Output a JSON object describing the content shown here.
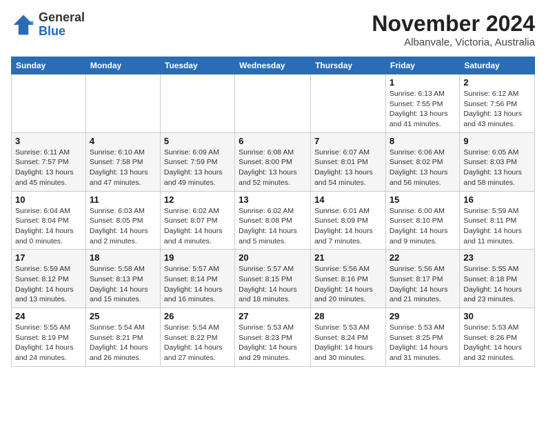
{
  "logo": {
    "general": "General",
    "blue": "Blue"
  },
  "header": {
    "month_year": "November 2024",
    "location": "Albanvale, Victoria, Australia"
  },
  "weekdays": [
    "Sunday",
    "Monday",
    "Tuesday",
    "Wednesday",
    "Thursday",
    "Friday",
    "Saturday"
  ],
  "weeks": [
    [
      {
        "day": "",
        "info": ""
      },
      {
        "day": "",
        "info": ""
      },
      {
        "day": "",
        "info": ""
      },
      {
        "day": "",
        "info": ""
      },
      {
        "day": "",
        "info": ""
      },
      {
        "day": "1",
        "info": "Sunrise: 6:13 AM\nSunset: 7:55 PM\nDaylight: 13 hours\nand 41 minutes."
      },
      {
        "day": "2",
        "info": "Sunrise: 6:12 AM\nSunset: 7:56 PM\nDaylight: 13 hours\nand 43 minutes."
      }
    ],
    [
      {
        "day": "3",
        "info": "Sunrise: 6:11 AM\nSunset: 7:57 PM\nDaylight: 13 hours\nand 45 minutes."
      },
      {
        "day": "4",
        "info": "Sunrise: 6:10 AM\nSunset: 7:58 PM\nDaylight: 13 hours\nand 47 minutes."
      },
      {
        "day": "5",
        "info": "Sunrise: 6:09 AM\nSunset: 7:59 PM\nDaylight: 13 hours\nand 49 minutes."
      },
      {
        "day": "6",
        "info": "Sunrise: 6:08 AM\nSunset: 8:00 PM\nDaylight: 13 hours\nand 52 minutes."
      },
      {
        "day": "7",
        "info": "Sunrise: 6:07 AM\nSunset: 8:01 PM\nDaylight: 13 hours\nand 54 minutes."
      },
      {
        "day": "8",
        "info": "Sunrise: 6:06 AM\nSunset: 8:02 PM\nDaylight: 13 hours\nand 56 minutes."
      },
      {
        "day": "9",
        "info": "Sunrise: 6:05 AM\nSunset: 8:03 PM\nDaylight: 13 hours\nand 58 minutes."
      }
    ],
    [
      {
        "day": "10",
        "info": "Sunrise: 6:04 AM\nSunset: 8:04 PM\nDaylight: 14 hours\nand 0 minutes."
      },
      {
        "day": "11",
        "info": "Sunrise: 6:03 AM\nSunset: 8:05 PM\nDaylight: 14 hours\nand 2 minutes."
      },
      {
        "day": "12",
        "info": "Sunrise: 6:02 AM\nSunset: 8:07 PM\nDaylight: 14 hours\nand 4 minutes."
      },
      {
        "day": "13",
        "info": "Sunrise: 6:02 AM\nSunset: 8:08 PM\nDaylight: 14 hours\nand 5 minutes."
      },
      {
        "day": "14",
        "info": "Sunrise: 6:01 AM\nSunset: 8:09 PM\nDaylight: 14 hours\nand 7 minutes."
      },
      {
        "day": "15",
        "info": "Sunrise: 6:00 AM\nSunset: 8:10 PM\nDaylight: 14 hours\nand 9 minutes."
      },
      {
        "day": "16",
        "info": "Sunrise: 5:59 AM\nSunset: 8:11 PM\nDaylight: 14 hours\nand 11 minutes."
      }
    ],
    [
      {
        "day": "17",
        "info": "Sunrise: 5:59 AM\nSunset: 8:12 PM\nDaylight: 14 hours\nand 13 minutes."
      },
      {
        "day": "18",
        "info": "Sunrise: 5:58 AM\nSunset: 8:13 PM\nDaylight: 14 hours\nand 15 minutes."
      },
      {
        "day": "19",
        "info": "Sunrise: 5:57 AM\nSunset: 8:14 PM\nDaylight: 14 hours\nand 16 minutes."
      },
      {
        "day": "20",
        "info": "Sunrise: 5:57 AM\nSunset: 8:15 PM\nDaylight: 14 hours\nand 18 minutes."
      },
      {
        "day": "21",
        "info": "Sunrise: 5:56 AM\nSunset: 8:16 PM\nDaylight: 14 hours\nand 20 minutes."
      },
      {
        "day": "22",
        "info": "Sunrise: 5:56 AM\nSunset: 8:17 PM\nDaylight: 14 hours\nand 21 minutes."
      },
      {
        "day": "23",
        "info": "Sunrise: 5:55 AM\nSunset: 8:18 PM\nDaylight: 14 hours\nand 23 minutes."
      }
    ],
    [
      {
        "day": "24",
        "info": "Sunrise: 5:55 AM\nSunset: 8:19 PM\nDaylight: 14 hours\nand 24 minutes."
      },
      {
        "day": "25",
        "info": "Sunrise: 5:54 AM\nSunset: 8:21 PM\nDaylight: 14 hours\nand 26 minutes."
      },
      {
        "day": "26",
        "info": "Sunrise: 5:54 AM\nSunset: 8:22 PM\nDaylight: 14 hours\nand 27 minutes."
      },
      {
        "day": "27",
        "info": "Sunrise: 5:53 AM\nSunset: 8:23 PM\nDaylight: 14 hours\nand 29 minutes."
      },
      {
        "day": "28",
        "info": "Sunrise: 5:53 AM\nSunset: 8:24 PM\nDaylight: 14 hours\nand 30 minutes."
      },
      {
        "day": "29",
        "info": "Sunrise: 5:53 AM\nSunset: 8:25 PM\nDaylight: 14 hours\nand 31 minutes."
      },
      {
        "day": "30",
        "info": "Sunrise: 5:53 AM\nSunset: 8:26 PM\nDaylight: 14 hours\nand 32 minutes."
      }
    ]
  ]
}
